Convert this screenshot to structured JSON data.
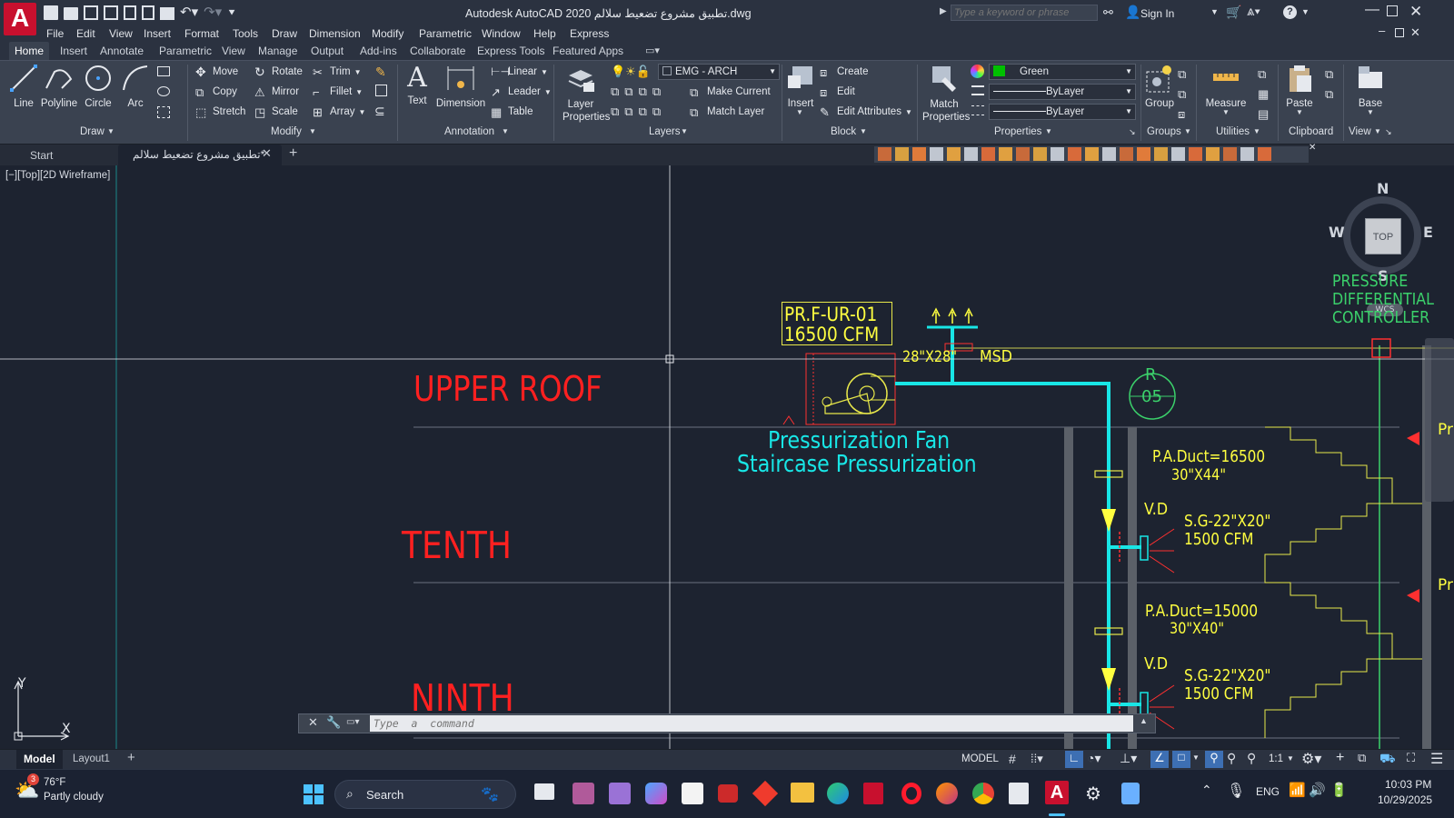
{
  "app": {
    "title": "Autodesk AutoCAD 2020  تطبيق مشروع تضعيط سلالم.dwg",
    "logo_letter": "A",
    "search_placeholder": "Type a keyword or phrase",
    "sign_in": "Sign In"
  },
  "menu": [
    "File",
    "Edit",
    "View",
    "Insert",
    "Format",
    "Tools",
    "Draw",
    "Dimension",
    "Modify",
    "Parametric",
    "Window",
    "Help",
    "Express"
  ],
  "ribbon_tabs": [
    "Home",
    "Insert",
    "Annotate",
    "Parametric",
    "View",
    "Manage",
    "Output",
    "Add-ins",
    "Collaborate",
    "Express Tools",
    "Featured Apps"
  ],
  "ribbon": {
    "draw": {
      "title": "Draw",
      "line": "Line",
      "polyline": "Polyline",
      "circle": "Circle",
      "arc": "Arc"
    },
    "modify": {
      "title": "Modify",
      "move": "Move",
      "rotate": "Rotate",
      "trim": "Trim",
      "copy": "Copy",
      "mirror": "Mirror",
      "fillet": "Fillet",
      "stretch": "Stretch",
      "scale": "Scale",
      "array": "Array"
    },
    "annotation": {
      "title": "Annotation",
      "text": "Text",
      "dimension": "Dimension",
      "linear": "Linear",
      "leader": "Leader",
      "table": "Table"
    },
    "layers": {
      "title": "Layers",
      "layer_properties": "Layer Properties",
      "current_layer": "EMG - ARCH",
      "make_current": "Make Current",
      "match_layer": "Match Layer"
    },
    "block": {
      "title": "Block",
      "insert": "Insert",
      "create": "Create",
      "edit": "Edit",
      "edit_attributes": "Edit Attributes"
    },
    "properties": {
      "title": "Properties",
      "match_properties": "Match Properties",
      "color": "Green",
      "color_hex": "#00c000",
      "linetype": "ByLayer",
      "lineweight": "ByLayer"
    },
    "groups": {
      "title": "Groups",
      "group": "Group"
    },
    "utilities": {
      "title": "Utilities",
      "measure": "Measure"
    },
    "clipboard": {
      "title": "Clipboard",
      "paste": "Paste"
    },
    "view": {
      "title": "View",
      "base": "Base"
    }
  },
  "doc_tabs": {
    "start": "Start",
    "file": "تطبيق مشروع تضعيط سلالم*"
  },
  "viewport": {
    "label": "[−][Top][2D Wireframe]",
    "viewcube": {
      "top": "TOP",
      "n": "N",
      "s": "S",
      "e": "E",
      "w": "W",
      "wcs": "WCS"
    },
    "ucs": {
      "x": "X",
      "y": "Y"
    }
  },
  "drawing": {
    "levels": [
      "UPPER ROOF",
      "TENTH",
      "NINTH"
    ],
    "fan_tag_line1": "PR.F-UR-01",
    "fan_tag_line2": "16500 CFM",
    "duct_size_top": "28\"X28\"",
    "msd": "MSD",
    "riser_tag_1": "R",
    "riser_tag_2": "05",
    "fan_desc_1": "Pressurization Fan",
    "fan_desc_2": "Staircase Pressurization",
    "pdc_1": "PRESSURE",
    "pdc_2": "DIFFERENTIAL",
    "pdc_3": "CONTROLLER",
    "duct_1_name": "P.A.Duct=16500",
    "duct_1_size": "30\"X44\"",
    "vd_1": "V.D",
    "grille_1_size": "S.G-22\"X20\"",
    "grille_1_cfm": "1500 CFM",
    "duct_2_name": "P.A.Duct=15000",
    "duct_2_size": "30\"X40\"",
    "vd_2": "V.D",
    "grille_2_size": "S.G-22\"X20\"",
    "grille_2_cfm": "1500 CFM",
    "edge_label_1": "Pr",
    "edge_label_2": "Pr",
    "colors": {
      "red": "#ff2020",
      "cyan": "#18e6e6",
      "yellow": "#ffff40",
      "green": "#3bd16b"
    }
  },
  "command": {
    "placeholder": "Type  a  command"
  },
  "layout_tabs": [
    "Model",
    "Layout1"
  ],
  "status": {
    "model": "MODEL",
    "scale": "1:1"
  },
  "taskbar": {
    "weather_temp": "76°F",
    "weather_desc": "Partly cloudy",
    "weather_badge": "3",
    "search": "Search",
    "lang": "ENG",
    "time": "10:03 PM",
    "date": "10/29/2025"
  }
}
